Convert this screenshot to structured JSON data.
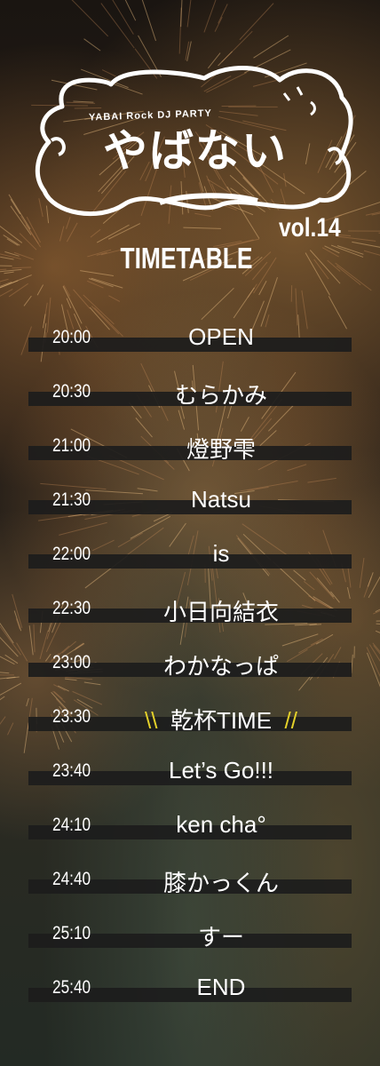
{
  "event": {
    "brand_subtitle": "YABAI Rock DJ PARTY",
    "brand_name": "やばない",
    "volume": "vol.14",
    "title": "TIMETABLE"
  },
  "timetable": [
    {
      "time": "20:00",
      "act": "OPEN"
    },
    {
      "time": "20:30",
      "act": "むらかみ"
    },
    {
      "time": "21:00",
      "act": "燈野雫"
    },
    {
      "time": "21:30",
      "act": "Natsu"
    },
    {
      "time": "22:00",
      "act": "is"
    },
    {
      "time": "22:30",
      "act": "小日向結衣"
    },
    {
      "time": "23:00",
      "act": "わかなっぱ"
    },
    {
      "time": "23:30",
      "act": "乾杯TIME",
      "deco_left": "\\\\",
      "deco_right": "//"
    },
    {
      "time": "23:40",
      "act": "Let’s Go!!!"
    },
    {
      "time": "24:10",
      "act": "ken cha°"
    },
    {
      "time": "24:40",
      "act": "膝かっくん"
    },
    {
      "time": "25:10",
      "act": "すー"
    },
    {
      "time": "25:40",
      "act": "END"
    }
  ],
  "colors": {
    "text": "#ffffff",
    "bar": "#1c1c1c",
    "accent": "#e3d02a"
  }
}
